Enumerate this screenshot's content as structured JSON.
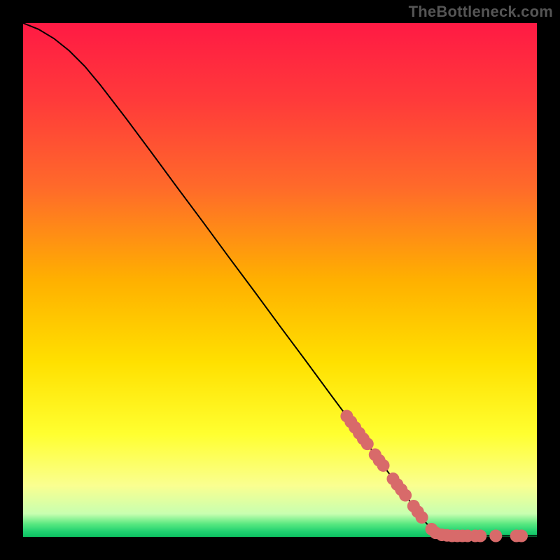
{
  "watermark": "TheBottleneck.com",
  "chart_data": {
    "type": "line",
    "title": "",
    "xlabel": "",
    "ylabel": "",
    "xlim": [
      0,
      100
    ],
    "ylim": [
      0,
      100
    ],
    "grid": false,
    "gradient_stops": [
      {
        "pct": 0.0,
        "color": "#ff1a44"
      },
      {
        "pct": 0.15,
        "color": "#ff3a3a"
      },
      {
        "pct": 0.32,
        "color": "#ff6a2a"
      },
      {
        "pct": 0.5,
        "color": "#ffb000"
      },
      {
        "pct": 0.66,
        "color": "#ffe000"
      },
      {
        "pct": 0.8,
        "color": "#ffff30"
      },
      {
        "pct": 0.9,
        "color": "#faff90"
      },
      {
        "pct": 0.955,
        "color": "#c8ffb0"
      },
      {
        "pct": 0.975,
        "color": "#58e880"
      },
      {
        "pct": 0.99,
        "color": "#1fd070"
      },
      {
        "pct": 1.0,
        "color": "#0cc060"
      }
    ],
    "series": [
      {
        "name": "curve",
        "type": "line",
        "color": "#000000",
        "width": 2,
        "points": [
          {
            "x": 0,
            "y": 100.0
          },
          {
            "x": 3,
            "y": 98.8
          },
          {
            "x": 6,
            "y": 97.0
          },
          {
            "x": 9,
            "y": 94.6
          },
          {
            "x": 12,
            "y": 91.6
          },
          {
            "x": 15,
            "y": 88.0
          },
          {
            "x": 20,
            "y": 81.5
          },
          {
            "x": 25,
            "y": 74.8
          },
          {
            "x": 30,
            "y": 68.0
          },
          {
            "x": 35,
            "y": 61.3
          },
          {
            "x": 40,
            "y": 54.5
          },
          {
            "x": 45,
            "y": 47.8
          },
          {
            "x": 50,
            "y": 41.0
          },
          {
            "x": 55,
            "y": 34.3
          },
          {
            "x": 60,
            "y": 27.5
          },
          {
            "x": 65,
            "y": 20.8
          },
          {
            "x": 70,
            "y": 14.0
          },
          {
            "x": 75,
            "y": 7.3
          },
          {
            "x": 78,
            "y": 3.2
          },
          {
            "x": 80,
            "y": 1.0
          },
          {
            "x": 82,
            "y": 0.3
          },
          {
            "x": 85,
            "y": 0.2
          },
          {
            "x": 90,
            "y": 0.2
          },
          {
            "x": 95,
            "y": 0.2
          },
          {
            "x": 100,
            "y": 0.2
          }
        ]
      },
      {
        "name": "markers",
        "type": "scatter",
        "color": "#d86a6a",
        "radius": 9,
        "points": [
          {
            "x": 63.0,
            "y": 23.5
          },
          {
            "x": 63.8,
            "y": 22.4
          },
          {
            "x": 64.6,
            "y": 21.3
          },
          {
            "x": 65.4,
            "y": 20.2
          },
          {
            "x": 66.2,
            "y": 19.1
          },
          {
            "x": 67.0,
            "y": 18.1
          },
          {
            "x": 68.5,
            "y": 16.0
          },
          {
            "x": 69.3,
            "y": 14.9
          },
          {
            "x": 70.1,
            "y": 13.9
          },
          {
            "x": 72.0,
            "y": 11.3
          },
          {
            "x": 72.8,
            "y": 10.2
          },
          {
            "x": 73.6,
            "y": 9.2
          },
          {
            "x": 74.4,
            "y": 8.1
          },
          {
            "x": 76.0,
            "y": 6.0
          },
          {
            "x": 76.8,
            "y": 4.9
          },
          {
            "x": 77.6,
            "y": 3.8
          },
          {
            "x": 79.5,
            "y": 1.5
          },
          {
            "x": 80.3,
            "y": 0.8
          },
          {
            "x": 81.5,
            "y": 0.4
          },
          {
            "x": 82.5,
            "y": 0.3
          },
          {
            "x": 83.5,
            "y": 0.2
          },
          {
            "x": 84.5,
            "y": 0.2
          },
          {
            "x": 85.5,
            "y": 0.2
          },
          {
            "x": 86.5,
            "y": 0.2
          },
          {
            "x": 88.0,
            "y": 0.2
          },
          {
            "x": 89.0,
            "y": 0.2
          },
          {
            "x": 92.0,
            "y": 0.2
          },
          {
            "x": 96.0,
            "y": 0.2
          },
          {
            "x": 97.0,
            "y": 0.2
          }
        ]
      }
    ]
  }
}
